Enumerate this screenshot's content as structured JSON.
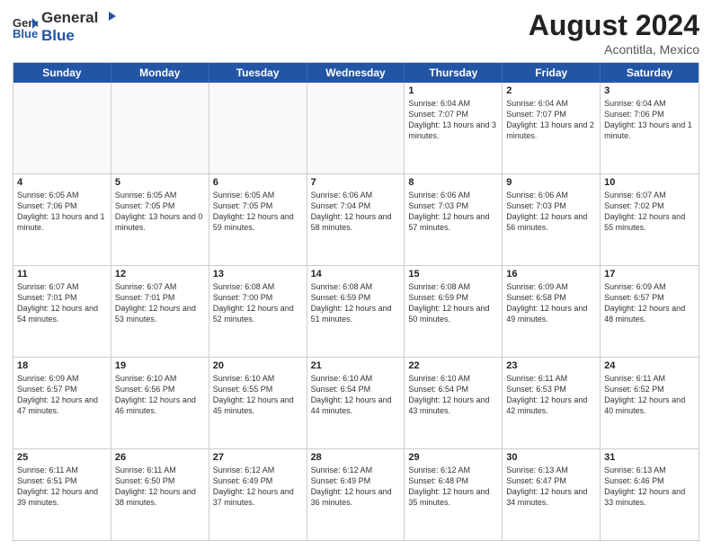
{
  "header": {
    "logo_general": "General",
    "logo_blue": "Blue",
    "month_year": "August 2024",
    "location": "Acontitla, Mexico"
  },
  "weekdays": [
    "Sunday",
    "Monday",
    "Tuesday",
    "Wednesday",
    "Thursday",
    "Friday",
    "Saturday"
  ],
  "rows": [
    [
      {
        "day": "",
        "empty": true
      },
      {
        "day": "",
        "empty": true
      },
      {
        "day": "",
        "empty": true
      },
      {
        "day": "",
        "empty": true
      },
      {
        "day": "1",
        "sunrise": "6:04 AM",
        "sunset": "7:07 PM",
        "daylight": "13 hours and 3 minutes."
      },
      {
        "day": "2",
        "sunrise": "6:04 AM",
        "sunset": "7:07 PM",
        "daylight": "13 hours and 2 minutes."
      },
      {
        "day": "3",
        "sunrise": "6:04 AM",
        "sunset": "7:06 PM",
        "daylight": "13 hours and 1 minute."
      }
    ],
    [
      {
        "day": "4",
        "sunrise": "6:05 AM",
        "sunset": "7:06 PM",
        "daylight": "13 hours and 1 minute."
      },
      {
        "day": "5",
        "sunrise": "6:05 AM",
        "sunset": "7:05 PM",
        "daylight": "13 hours and 0 minutes."
      },
      {
        "day": "6",
        "sunrise": "6:05 AM",
        "sunset": "7:05 PM",
        "daylight": "12 hours and 59 minutes."
      },
      {
        "day": "7",
        "sunrise": "6:06 AM",
        "sunset": "7:04 PM",
        "daylight": "12 hours and 58 minutes."
      },
      {
        "day": "8",
        "sunrise": "6:06 AM",
        "sunset": "7:03 PM",
        "daylight": "12 hours and 57 minutes."
      },
      {
        "day": "9",
        "sunrise": "6:06 AM",
        "sunset": "7:03 PM",
        "daylight": "12 hours and 56 minutes."
      },
      {
        "day": "10",
        "sunrise": "6:07 AM",
        "sunset": "7:02 PM",
        "daylight": "12 hours and 55 minutes."
      }
    ],
    [
      {
        "day": "11",
        "sunrise": "6:07 AM",
        "sunset": "7:01 PM",
        "daylight": "12 hours and 54 minutes."
      },
      {
        "day": "12",
        "sunrise": "6:07 AM",
        "sunset": "7:01 PM",
        "daylight": "12 hours and 53 minutes."
      },
      {
        "day": "13",
        "sunrise": "6:08 AM",
        "sunset": "7:00 PM",
        "daylight": "12 hours and 52 minutes."
      },
      {
        "day": "14",
        "sunrise": "6:08 AM",
        "sunset": "6:59 PM",
        "daylight": "12 hours and 51 minutes."
      },
      {
        "day": "15",
        "sunrise": "6:08 AM",
        "sunset": "6:59 PM",
        "daylight": "12 hours and 50 minutes."
      },
      {
        "day": "16",
        "sunrise": "6:09 AM",
        "sunset": "6:58 PM",
        "daylight": "12 hours and 49 minutes."
      },
      {
        "day": "17",
        "sunrise": "6:09 AM",
        "sunset": "6:57 PM",
        "daylight": "12 hours and 48 minutes."
      }
    ],
    [
      {
        "day": "18",
        "sunrise": "6:09 AM",
        "sunset": "6:57 PM",
        "daylight": "12 hours and 47 minutes."
      },
      {
        "day": "19",
        "sunrise": "6:10 AM",
        "sunset": "6:56 PM",
        "daylight": "12 hours and 46 minutes."
      },
      {
        "day": "20",
        "sunrise": "6:10 AM",
        "sunset": "6:55 PM",
        "daylight": "12 hours and 45 minutes."
      },
      {
        "day": "21",
        "sunrise": "6:10 AM",
        "sunset": "6:54 PM",
        "daylight": "12 hours and 44 minutes."
      },
      {
        "day": "22",
        "sunrise": "6:10 AM",
        "sunset": "6:54 PM",
        "daylight": "12 hours and 43 minutes."
      },
      {
        "day": "23",
        "sunrise": "6:11 AM",
        "sunset": "6:53 PM",
        "daylight": "12 hours and 42 minutes."
      },
      {
        "day": "24",
        "sunrise": "6:11 AM",
        "sunset": "6:52 PM",
        "daylight": "12 hours and 40 minutes."
      }
    ],
    [
      {
        "day": "25",
        "sunrise": "6:11 AM",
        "sunset": "6:51 PM",
        "daylight": "12 hours and 39 minutes."
      },
      {
        "day": "26",
        "sunrise": "6:11 AM",
        "sunset": "6:50 PM",
        "daylight": "12 hours and 38 minutes."
      },
      {
        "day": "27",
        "sunrise": "6:12 AM",
        "sunset": "6:49 PM",
        "daylight": "12 hours and 37 minutes."
      },
      {
        "day": "28",
        "sunrise": "6:12 AM",
        "sunset": "6:49 PM",
        "daylight": "12 hours and 36 minutes."
      },
      {
        "day": "29",
        "sunrise": "6:12 AM",
        "sunset": "6:48 PM",
        "daylight": "12 hours and 35 minutes."
      },
      {
        "day": "30",
        "sunrise": "6:13 AM",
        "sunset": "6:47 PM",
        "daylight": "12 hours and 34 minutes."
      },
      {
        "day": "31",
        "sunrise": "6:13 AM",
        "sunset": "6:46 PM",
        "daylight": "12 hours and 33 minutes."
      }
    ]
  ]
}
